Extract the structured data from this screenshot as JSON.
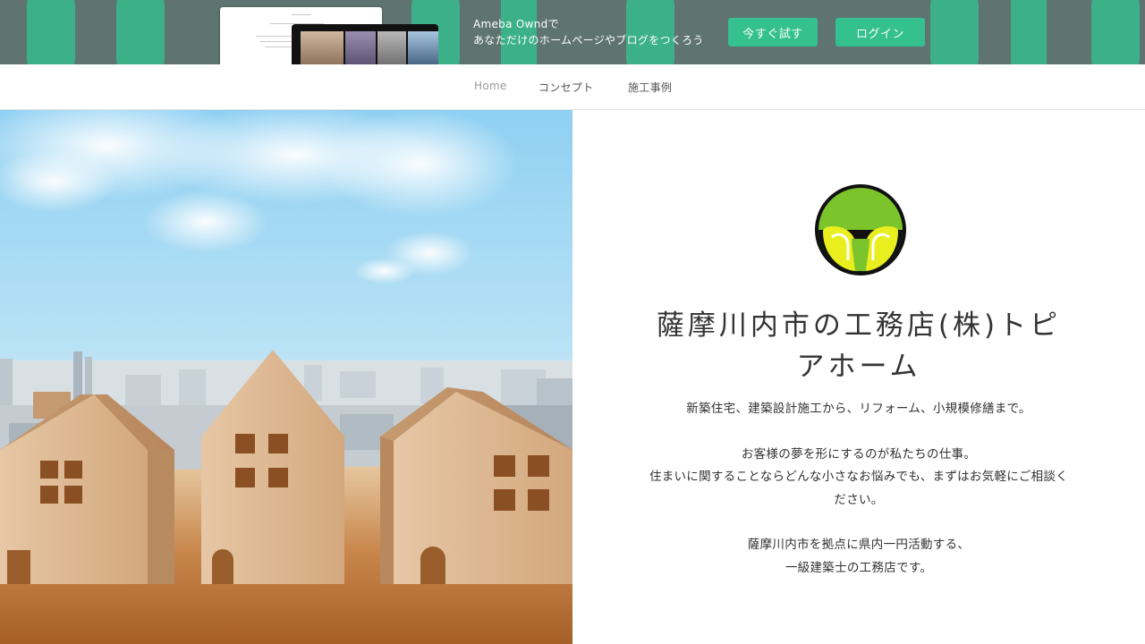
{
  "promo": {
    "line1": "Ameba Owndで",
    "line2": "あなただけのホームページやブログをつくろう",
    "try_label": "今すぐ試す",
    "login_label": "ログイン",
    "accent_color": "#34c08f"
  },
  "nav": {
    "items": [
      {
        "label": "Home"
      },
      {
        "label": "コンセプト"
      },
      {
        "label": "施工事例"
      }
    ]
  },
  "hero": {
    "image": "wooden-house-blocks-city-sky-photo"
  },
  "content": {
    "logo": "company-logo-green-yellow",
    "title_line1": "薩摩川内市の工務店(株)トピ",
    "title_line2": "アホーム",
    "desc": [
      "新築住宅、建築設計施工から、リフォーム、小規模修繕まで。",
      "お客様の夢を形にするのが私たちの仕事。",
      "住まいに関することならどんな小さなお悩みでも、まずはお気軽にご相談く",
      "ださい。",
      "薩摩川内市を拠点に県内一円活動する、",
      "一級建築士の工務店です。"
    ]
  }
}
